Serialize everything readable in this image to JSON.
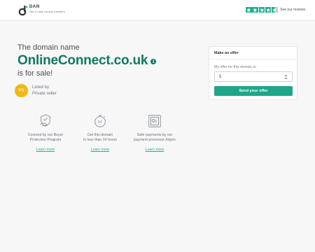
{
  "header": {
    "brand": "DAN",
    "tagline": "fast & easy domain transfers",
    "reviews_link": "See our reviews",
    "rating_stars": 4.5
  },
  "hero": {
    "intro": "The domain name",
    "domain": "OnlineConnect.co.uk",
    "for_sale": "is for sale!"
  },
  "seller": {
    "initials": "PS",
    "line1": "Listed by",
    "line2": "Private seller"
  },
  "features": [
    {
      "icon": "shield-hand-icon",
      "line1": "Covered by our Buyer",
      "line2": "Protection Program",
      "link": "Learn more"
    },
    {
      "icon": "clock-24-icon",
      "line1": "Get this domain",
      "line2": "in less than 24 hours",
      "link": "Learn more"
    },
    {
      "icon": "secure-payment-icon",
      "line1": "Safe payments by our",
      "line2": "payment processor Adyen",
      "link": "Learn more"
    }
  ],
  "offer": {
    "title": "Make an offer",
    "label": "My offer for this domain is:",
    "currency": "$",
    "value": "",
    "button": "Send your offer"
  },
  "colors": {
    "brand_green": "#0d7a5f",
    "accent": "#1fa68a",
    "avatar": "#f2b716"
  }
}
